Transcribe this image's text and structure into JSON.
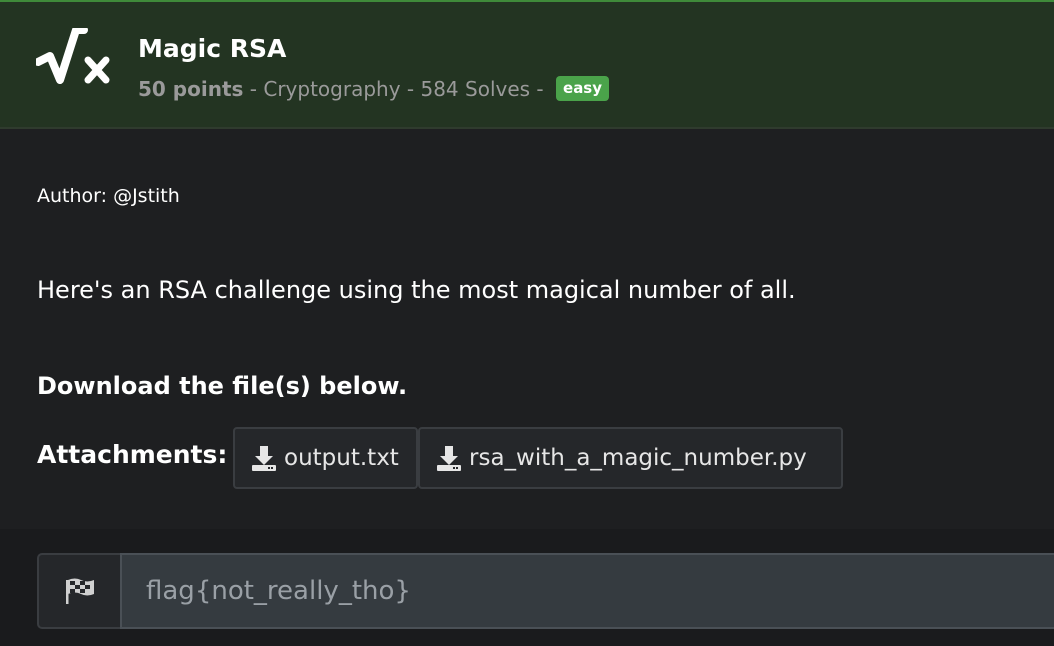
{
  "challenge": {
    "title": "Magic RSA",
    "points": "50 points",
    "separator1": " - ",
    "category": "Cryptography",
    "separator2": " - ",
    "solves": "584 Solves",
    "separator3": " - ",
    "difficulty": "easy",
    "icon": "sqrt-x-icon"
  },
  "body": {
    "author": "Author: @Jstith",
    "description": "Here's an RSA challenge using the most magical number of all.",
    "download_note": "Download the file(s) below.",
    "attachments_label": "Attachments:",
    "attachments": [
      {
        "name": "output.txt",
        "icon": "download-icon"
      },
      {
        "name": "rsa_with_a_magic_number.py",
        "icon": "download-icon"
      }
    ]
  },
  "flag": {
    "icon": "checkered-flag-icon",
    "placeholder": "flag{not_really_tho}",
    "value": ""
  },
  "colors": {
    "header_bg": "#233422",
    "badge_easy": "#4aa34a",
    "page_bg": "#1e1f21"
  }
}
